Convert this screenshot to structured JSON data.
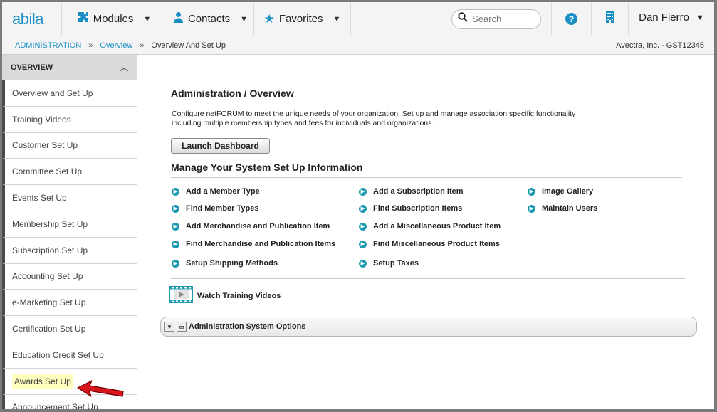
{
  "topnav": {
    "logo": "abila",
    "modules": "Modules",
    "contacts": "Contacts",
    "favorites": "Favorites",
    "search_placeholder": "Search",
    "user": "Dan Fierro"
  },
  "breadcrumb": {
    "items": [
      "ADMINISTRATION",
      "Overview",
      "Overview And Set Up"
    ],
    "right": "Avectra, Inc. - GST12345"
  },
  "sidebar": {
    "header": "OVERVIEW",
    "items": [
      "Overview and Set Up",
      "Training Videos",
      "Customer Set Up",
      "Committee Set Up",
      "Events Set Up",
      "Membership Set Up",
      "Subscription Set Up",
      "Accounting Set Up",
      "e-Marketing Set Up",
      "Certification Set Up",
      "Education Credit Set Up",
      "Awards Set Up",
      "Announcement Set Up"
    ]
  },
  "main": {
    "title": "Administration / Overview",
    "description": "Configure netFORUM to meet the unique needs of your organization. Set up and manage association specific functionality including multiple membership types and fees for individuals and organizations.",
    "launch_button": "Launch Dashboard",
    "manage_title": "Manage Your System Set Up Information",
    "links": [
      "Add a Member Type",
      "Find Member Types",
      "Add Merchandise and Publication Item",
      "Find Merchandise and Publication Items",
      "Setup Shipping Methods",
      "Add a Subscription Item",
      "Find Subscription Items",
      "Add a Miscellaneous Product Item",
      "Find Miscellaneous Product Items",
      "Setup Taxes",
      "Image Gallery",
      "Maintain Users"
    ],
    "training": "Watch Training Videos",
    "options": "Administration System Options"
  },
  "colors": {
    "accent": "#1a8fc4",
    "link_dot": "#1d9ab0",
    "highlight": "#ffffbe",
    "arrow": "#d9141a"
  }
}
